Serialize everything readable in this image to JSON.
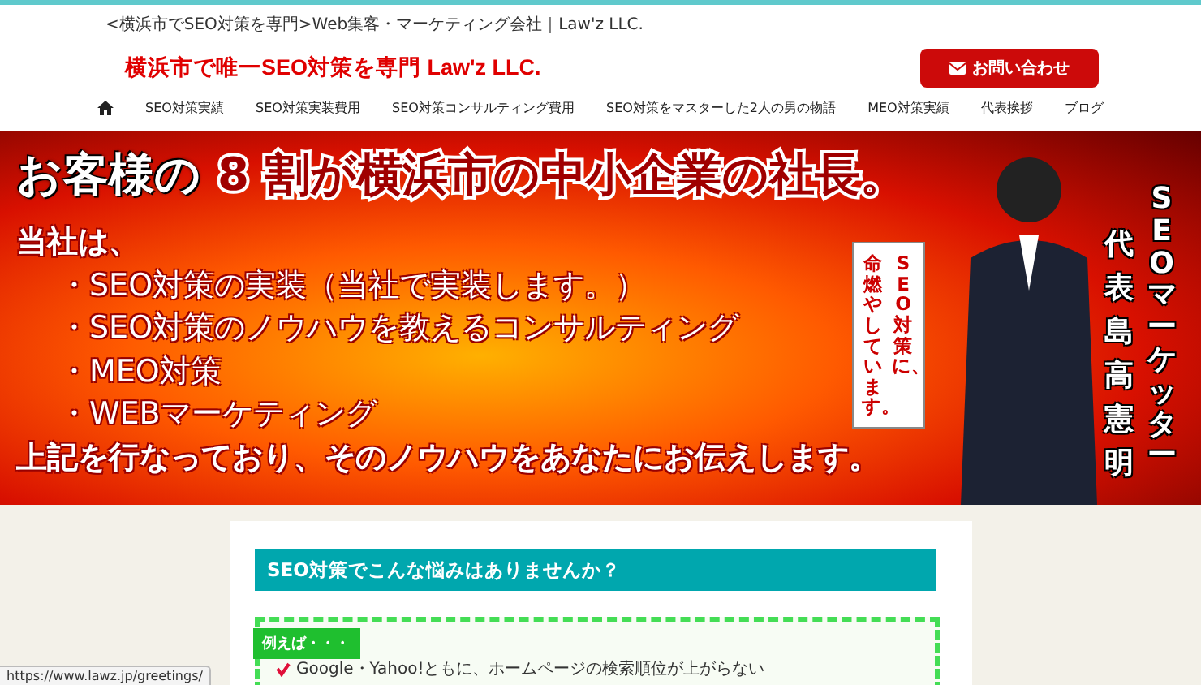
{
  "header": {
    "tagline": "<横浜市でSEO対策を専門>Web集客・マーケティング会社｜Law'z LLC.",
    "logo": "横浜市で唯一SEO対策を専門 Law'z LLC.",
    "contact_button": "お問い合わせ"
  },
  "nav": {
    "items": [
      {
        "kind": "home"
      },
      {
        "kind": "text",
        "label": "SEO対策実績"
      },
      {
        "kind": "text",
        "label": "SEO対策実装費用"
      },
      {
        "kind": "text",
        "label": "SEO対策コンサルティング費用"
      },
      {
        "kind": "text",
        "label": "SEO対策をマスターした2人の男の物語"
      },
      {
        "kind": "text",
        "label": "MEO対策実績"
      },
      {
        "kind": "text",
        "label": "代表挨拶"
      },
      {
        "kind": "text",
        "label": "ブログ"
      }
    ]
  },
  "banner": {
    "headline": [
      {
        "kind": "plain",
        "text": "お客様の"
      },
      {
        "kind": "accent",
        "text": "8 割が横浜市の中小企業の社長。"
      }
    ],
    "intro": "当社は、",
    "bullets": [
      "・SEO対策の実装（当社で実装します。）",
      "・SEO対策のノウハウを教えるコンサルティング",
      "・MEO対策",
      "・WEBマーケティング"
    ],
    "closing": "上記を行なっており、そのノウハウをあなたにお伝えします。",
    "speech_bubble": [
      "命燃やしています。",
      "SEO対策に、"
    ],
    "vertical_label": [
      "代表島高憲明",
      "SEOマーケッター"
    ]
  },
  "card": {
    "heading": "SEO対策でこんな悩みはありませんか？",
    "example_label": "例えば・・・",
    "items": [
      "Google・Yahoo!ともに、ホームページの検索順位が上がらない"
    ]
  },
  "status_url": "https://www.lawz.jp/greetings/"
}
